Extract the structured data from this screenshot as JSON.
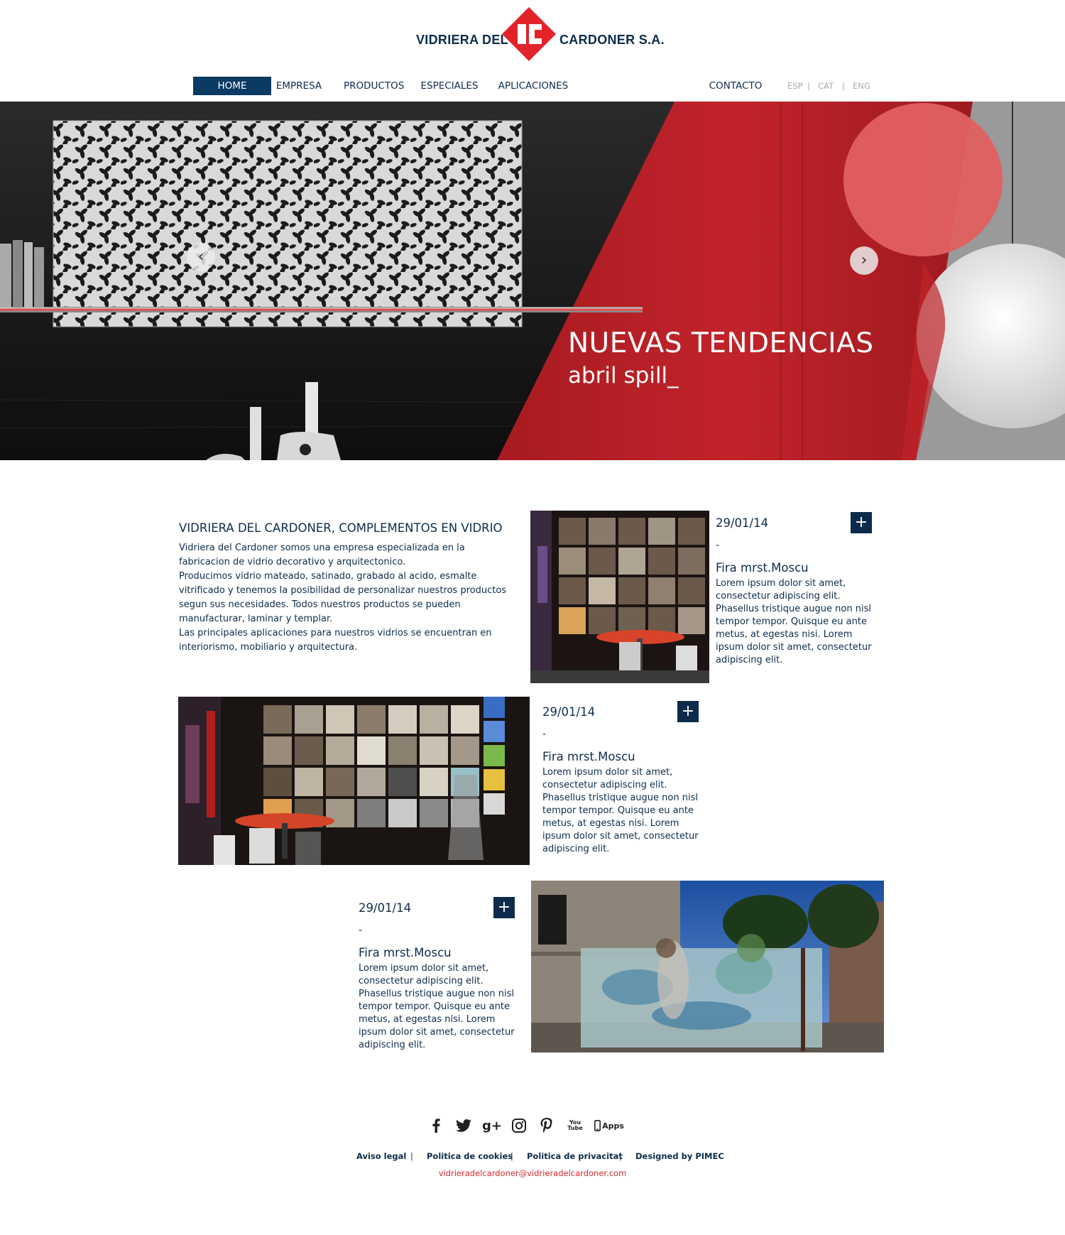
{
  "brand": {
    "left": "VIDRIERA DEL",
    "right": "CARDONER S.A.",
    "accent": "#e2232a",
    "navy": "#0d2c4b"
  },
  "nav": {
    "items": [
      "HOME",
      "EMPRESA",
      "PRODUCTOS",
      "ESPECIALES",
      "APLICACIONES"
    ],
    "contact": "CONTACTO",
    "langs": [
      "ESP",
      "CAT",
      "ENG"
    ],
    "separator": "|"
  },
  "hero": {
    "title": "NUEVAS TENDENCIAS",
    "subtitle": "abril spill_",
    "prev_icon": "chevron-left-icon",
    "next_icon": "chevron-right-icon"
  },
  "intro": {
    "title": "VIDRIERA DEL CARDONER, COMPLEMENTOS EN VIDRIO",
    "paragraphs": [
      "Vidriera del Cardoner somos una empresa especializada en la fabricacion de vidrio decorativo y arquitectonico.",
      "Producimos vidrio mateado, satinado, grabado al acido, esmalte vitrificado y tenemos la posibilidad de personalizar nuestros productos segun sus necesidades. Todos nuestros productos se pueden manufacturar, laminar y templar.",
      "Las principales aplicaciones para nuestros vidrios se encuentran en interiorismo, mobiliario y arquitectura."
    ]
  },
  "news": [
    {
      "date": "29/01/14",
      "plus": "+",
      "dash": "-",
      "title": "Fira mrst.Moscu",
      "text": "Lorem ipsum dolor sit amet, consectetur adipiscing elit. Phasellus tristique augue non nisl tempor tempor. Quisque eu ante metus, at egestas nisi. Lorem ipsum dolor sit amet, consectetur adipiscing elit."
    },
    {
      "date": "29/01/14",
      "plus": "+",
      "dash": "-",
      "title": "Fira mrst.Moscu",
      "text": "Lorem ipsum dolor sit amet, consectetur adipiscing elit. Phasellus tristique augue non nisl tempor tempor. Quisque eu ante metus, at egestas nisi. Lorem ipsum dolor sit amet, consectetur adipiscing elit."
    },
    {
      "date": "29/01/14",
      "plus": "+",
      "dash": "-",
      "title": "Fira mrst.Moscu",
      "text": "Lorem ipsum dolor sit amet, consectetur adipiscing elit. Phasellus tristique augue non nisl tempor tempor. Quisque eu ante metus, at egestas nisi. Lorem ipsum dolor sit amet, consectetur adipiscing elit."
    }
  ],
  "social": [
    "facebook-icon",
    "twitter-icon",
    "google-plus-icon",
    "instagram-icon",
    "pinterest-icon",
    "youtube-icon",
    "apps-icon"
  ],
  "social_labels": {
    "gplus": "g+",
    "youtube": "You\nTube",
    "apps": "Apps"
  },
  "footer": {
    "links": [
      "Aviso legal",
      "Politica de cookies",
      "Politica de privacitat",
      "Designed by PIMEC"
    ],
    "separator": "|",
    "email": "vidrieradelcardoner@vidrieradelcardoner.com"
  }
}
